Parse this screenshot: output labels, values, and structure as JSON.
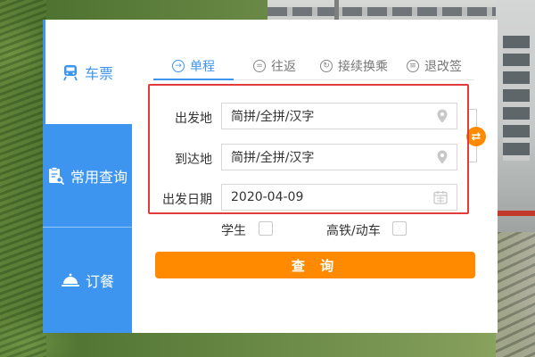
{
  "sidebar": {
    "items": [
      {
        "label": "车票",
        "icon": "train-icon",
        "active": true
      },
      {
        "label": "常用查询",
        "icon": "clipboard-search-icon",
        "active": false
      },
      {
        "label": "订餐",
        "icon": "food-cloche-icon",
        "active": false
      }
    ]
  },
  "tabs": [
    {
      "label": "单程",
      "icon": "arrow-circle-icon",
      "active": true
    },
    {
      "label": "往返",
      "icon": "equals-circle-icon",
      "active": false
    },
    {
      "label": "接续换乘",
      "icon": "refresh-circle-icon",
      "active": false
    },
    {
      "label": "退改签",
      "icon": "ticket-circle-icon",
      "active": false
    }
  ],
  "form": {
    "from": {
      "label": "出发地",
      "value": "简拼/全拼/汉字",
      "icon": "location-pin-icon"
    },
    "to": {
      "label": "到达地",
      "value": "简拼/全拼/汉字",
      "icon": "location-pin-icon"
    },
    "date": {
      "label": "出发日期",
      "value": "2020-04-09",
      "icon": "calendar-icon"
    },
    "swap_icon": "swap-arrows-icon"
  },
  "options": {
    "student_label": "学生",
    "student_checked": false,
    "highspeed_label": "高铁/动车",
    "highspeed_checked": false
  },
  "search_label": "查 询",
  "colors": {
    "primary": "#3d95f0",
    "accent": "#ff8a00",
    "highlight": "#e23b3b"
  }
}
